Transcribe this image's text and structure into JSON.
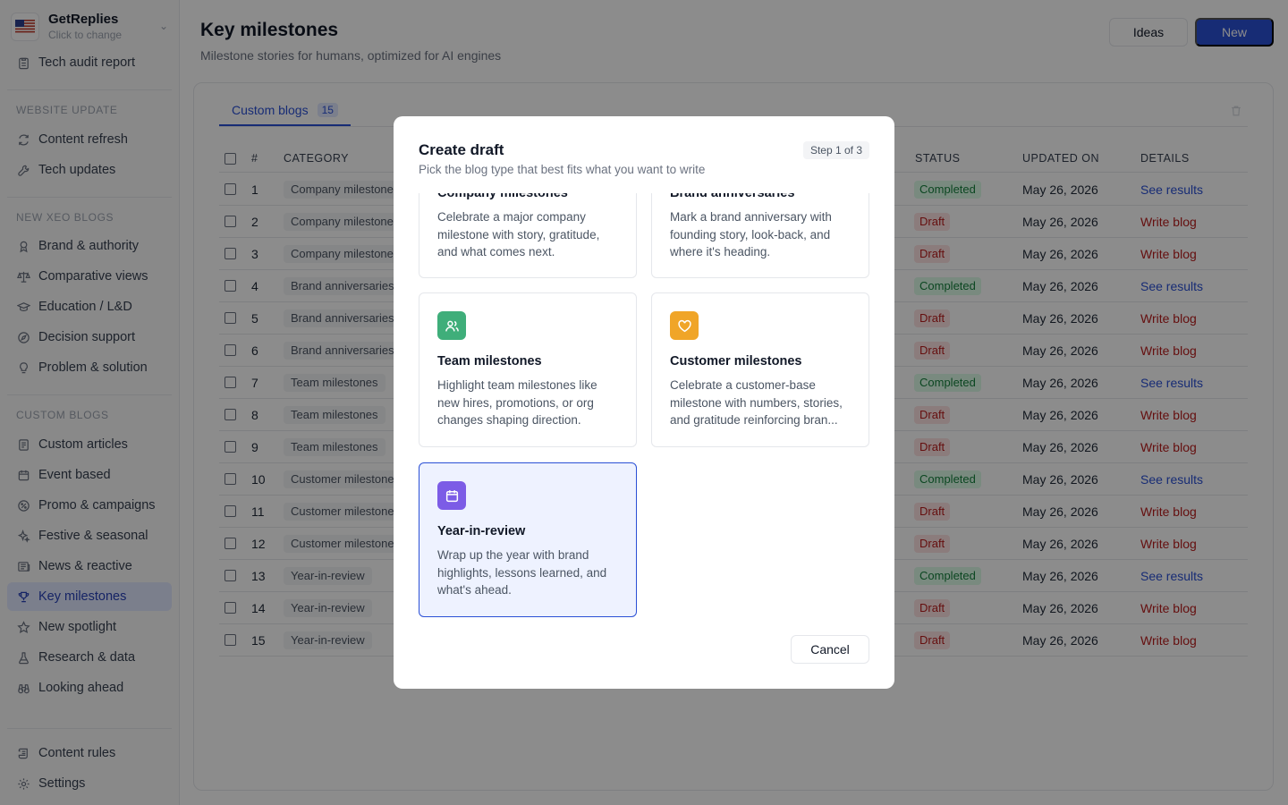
{
  "workspace": {
    "name": "GetReplies",
    "sub": "Click to change"
  },
  "sidebar": {
    "top_item": "Tech audit report",
    "sections": [
      {
        "title": "WEBSITE UPDATE",
        "items": [
          "Content refresh",
          "Tech updates"
        ]
      },
      {
        "title": "NEW XEO BLOGS",
        "items": [
          "Brand & authority",
          "Comparative views",
          "Education / L&D",
          "Decision support",
          "Problem & solution"
        ]
      },
      {
        "title": "CUSTOM BLOGS",
        "items": [
          "Custom articles",
          "Event based",
          "Promo & campaigns",
          "Festive & seasonal",
          "News & reactive",
          "Key milestones",
          "New spotlight",
          "Research & data",
          "Looking ahead"
        ]
      }
    ],
    "bottom": [
      "Content rules",
      "Settings"
    ]
  },
  "header": {
    "title": "Key milestones",
    "subtitle": "Milestone stories for humans, optimized for AI engines",
    "ideas_label": "Ideas",
    "new_label": "New"
  },
  "tabs": [
    {
      "label": "Custom blogs",
      "count": "15"
    }
  ],
  "table": {
    "columns": [
      "#",
      "CATEGORY",
      "STATUS",
      "UPDATED ON",
      "DETAILS"
    ],
    "rows": [
      {
        "n": "1",
        "category": "Company milestone",
        "status": "Completed",
        "updated": "May 26, 2026",
        "details": "See results"
      },
      {
        "n": "2",
        "category": "Company milestone",
        "status": "Draft",
        "updated": "May 26, 2026",
        "details": "Write blog"
      },
      {
        "n": "3",
        "category": "Company milestone",
        "status": "Draft",
        "updated": "May 26, 2026",
        "details": "Write blog"
      },
      {
        "n": "4",
        "category": "Brand anniversaries",
        "status": "Completed",
        "updated": "May 26, 2026",
        "details": "See results"
      },
      {
        "n": "5",
        "category": "Brand anniversaries",
        "status": "Draft",
        "updated": "May 26, 2026",
        "details": "Write blog"
      },
      {
        "n": "6",
        "category": "Brand anniversaries",
        "status": "Draft",
        "updated": "May 26, 2026",
        "details": "Write blog"
      },
      {
        "n": "7",
        "category": "Team milestones",
        "status": "Completed",
        "updated": "May 26, 2026",
        "details": "See results"
      },
      {
        "n": "8",
        "category": "Team milestones",
        "status": "Draft",
        "updated": "May 26, 2026",
        "details": "Write blog"
      },
      {
        "n": "9",
        "category": "Team milestones",
        "status": "Draft",
        "updated": "May 26, 2026",
        "details": "Write blog"
      },
      {
        "n": "10",
        "category": "Customer milestone",
        "status": "Completed",
        "updated": "May 26, 2026",
        "details": "See results"
      },
      {
        "n": "11",
        "category": "Customer milestone",
        "status": "Draft",
        "updated": "May 26, 2026",
        "details": "Write blog"
      },
      {
        "n": "12",
        "category": "Customer milestone",
        "status": "Draft",
        "updated": "May 26, 2026",
        "details": "Write blog"
      },
      {
        "n": "13",
        "category": "Year-in-review",
        "status": "Completed",
        "updated": "May 26, 2026",
        "details": "See results"
      },
      {
        "n": "14",
        "category": "Year-in-review",
        "status": "Draft",
        "updated": "May 26, 2026",
        "details": "Write blog"
      },
      {
        "n": "15",
        "category": "Year-in-review",
        "status": "Draft",
        "updated": "May 26, 2026",
        "details": "Write blog"
      }
    ]
  },
  "modal": {
    "title": "Create draft",
    "subtitle": "Pick the blog type that best fits what you want to write",
    "step": "Step 1 of 3",
    "options": [
      {
        "title": "Company milestones",
        "desc": "Celebrate a major company milestone with story, gratitude, and what comes next.",
        "icon": "flag-icon",
        "color": "#3b82f6"
      },
      {
        "title": "Brand anniversaries",
        "desc": "Mark a brand anniversary with founding story, look-back, and where it's heading.",
        "icon": "cake-icon",
        "color": "#ec4899"
      },
      {
        "title": "Team milestones",
        "desc": "Highlight team milestones like new hires, promotions, or org changes shaping direction.",
        "icon": "users-icon",
        "color": "#3fae7a"
      },
      {
        "title": "Customer milestones",
        "desc": "Celebrate a customer-base milestone with numbers, stories, and gratitude reinforcing bran...",
        "icon": "heart-icon",
        "color": "#f0a528"
      },
      {
        "title": "Year-in-review",
        "desc": "Wrap up the year with brand highlights, lessons learned, and what's ahead.",
        "icon": "calendar-icon",
        "color": "#7c5ce6",
        "selected": true
      }
    ],
    "cancel_label": "Cancel"
  },
  "colors": {
    "accent": "#2b50d6",
    "completed": "#15803d",
    "draft": "#b91c1c"
  }
}
